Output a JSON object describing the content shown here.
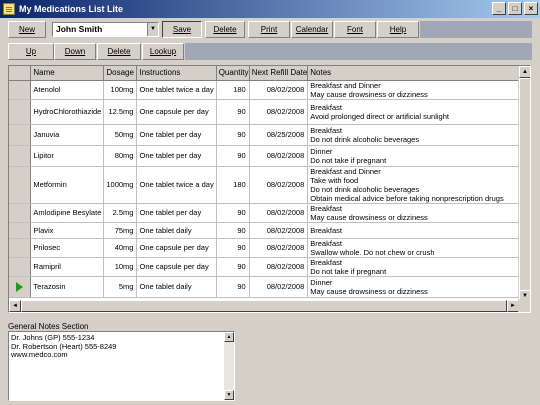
{
  "window": {
    "title": "My Medications List Lite",
    "buttons": [
      "_",
      "□",
      "×"
    ]
  },
  "toolbar": {
    "new_label": "New",
    "patient_name": "John Smith",
    "save_label": "Save",
    "delete_label": "Delete",
    "print_label": "Print",
    "calendar_label": "Calendar",
    "font_label": "Font",
    "help_label": "Help"
  },
  "row_toolbar": {
    "up_label": "Up",
    "down_label": "Down",
    "delete_label": "Delete",
    "lookup_label": "Lookup"
  },
  "table": {
    "columns": [
      "Name",
      "Dosage",
      "Instructions",
      "Quantity",
      "Next Refill Date",
      "Notes"
    ],
    "rows": [
      {
        "name": "Atenolol",
        "dosage": "100mg",
        "instructions": "One tablet twice a day",
        "quantity": "180",
        "refill": "08/02/2008",
        "notes": [
          "Breakfast and Dinner",
          "May cause drowsiness or dizziness"
        ],
        "current": false
      },
      {
        "name": "HydroChlorothiazide",
        "dosage": "12.5mg",
        "instructions": "One capsule per day",
        "quantity": "90",
        "refill": "08/02/2008",
        "notes": [
          "Breakfast",
          "Avoid prolonged direct or artificial sunlight"
        ],
        "current": false
      },
      {
        "name": "Januvia",
        "dosage": "50mg",
        "instructions": "One tablet per day",
        "quantity": "90",
        "refill": "08/25/2008",
        "notes": [
          "Breakfast",
          "Do not drink alcoholic beverages"
        ],
        "current": false
      },
      {
        "name": "Lipitor",
        "dosage": "80mg",
        "instructions": "One tablet per day",
        "quantity": "90",
        "refill": "08/02/2008",
        "notes": [
          "Dinner",
          "Do not take if pregnant"
        ],
        "current": false
      },
      {
        "name": "Metformin",
        "dosage": "1000mg",
        "instructions": "One tablet twice a day",
        "quantity": "180",
        "refill": "08/02/2008",
        "notes": [
          "Breakfast and Dinner",
          "Take with food",
          "Do not drink alcoholic beverages",
          "Obtain medical advice before taking nonprescription drugs"
        ],
        "current": false
      },
      {
        "name": "Amlodipine Besylate",
        "dosage": "2.5mg",
        "instructions": "One tablet per day",
        "quantity": "90",
        "refill": "08/02/2008",
        "notes": [
          "Breakfast",
          "May cause drowsiness or dizziness"
        ],
        "current": false
      },
      {
        "name": "Plavix",
        "dosage": "75mg",
        "instructions": "One tablet daily",
        "quantity": "90",
        "refill": "08/02/2008",
        "notes": [
          "Breakfast"
        ],
        "current": false
      },
      {
        "name": "Prilosec",
        "dosage": "40mg",
        "instructions": "One capsule per day",
        "quantity": "90",
        "refill": "08/02/2008",
        "notes": [
          "Breakfast",
          "Swallow whole.  Do not chew or crush"
        ],
        "current": false
      },
      {
        "name": "Ramipril",
        "dosage": "10mg",
        "instructions": "One capsule per day",
        "quantity": "90",
        "refill": "08/02/2008",
        "notes": [
          "Breakfast",
          "Do not take if pregnant"
        ],
        "current": false
      },
      {
        "name": "Terazosin",
        "dosage": "5mg",
        "instructions": "One tablet daily",
        "quantity": "90",
        "refill": "08/02/2008",
        "notes": [
          "Dinner",
          "May cause drowsiness or dizziness"
        ],
        "current": true
      }
    ]
  },
  "general_notes": {
    "label": "General Notes Section",
    "lines": [
      "Dr. Johns (GP)  555-1234",
      "Dr. Robertson (Heart)  555-8249",
      "www.medco.com"
    ]
  },
  "icons": {
    "current_row": "green-triangle-icon",
    "combo": "chevron-down-icon"
  },
  "colors": {
    "title_start": "#0a246a",
    "title_end": "#a6caf0",
    "current_row_marker": "#1a9e1a"
  }
}
